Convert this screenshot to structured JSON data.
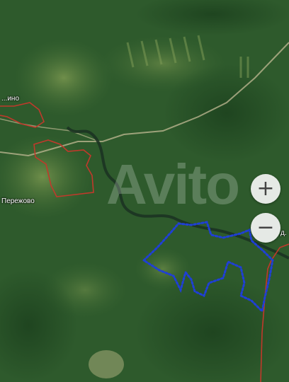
{
  "map": {
    "watermark": "Avito",
    "labels": {
      "village_top": "...ино",
      "village_left": "Пережово",
      "right_edge": "д."
    },
    "controls": {
      "zoom_in": "+",
      "zoom_out": "−"
    },
    "colors": {
      "boundary_red": "#c0392b",
      "plot_blue": "#1f3fd6"
    }
  }
}
